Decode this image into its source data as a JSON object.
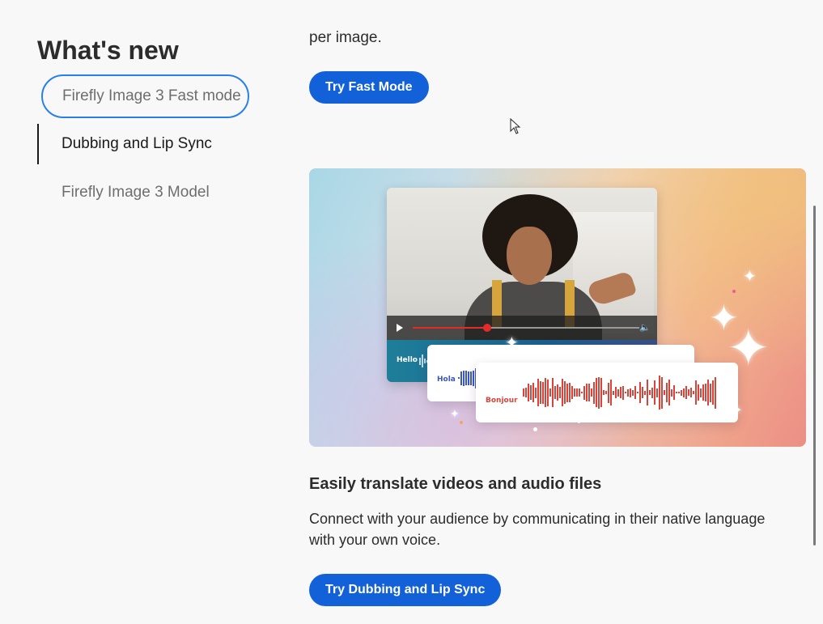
{
  "sidebar": {
    "title": "What's new",
    "items": [
      {
        "label": "Firefly Image 3 Fast mode",
        "state": "focused"
      },
      {
        "label": "Dubbing and Lip Sync",
        "state": "active"
      },
      {
        "label": "Firefly Image 3 Model",
        "state": "default"
      }
    ]
  },
  "main": {
    "previous_section_tail": "per image.",
    "fast_mode_button": "Try Fast Mode",
    "hero_media": {
      "labels": {
        "english": "Hello",
        "spanish": "Hola",
        "french": "Bonjour"
      },
      "playback_progress": 0.33
    },
    "section_title": "Easily translate videos and audio files",
    "section_body": "Connect with your audience by communicating in their native language with your own voice.",
    "dubbing_button": "Try Dubbing and Lip Sync"
  },
  "colors": {
    "accent": "#1361d8",
    "focus_ring": "#2680eb",
    "wave_blue": "#3a57c4",
    "wave_red": "#d9443a"
  },
  "icons": [
    "play-icon",
    "volume-icon",
    "sparkle-icon",
    "mouse-pointer-icon"
  ]
}
